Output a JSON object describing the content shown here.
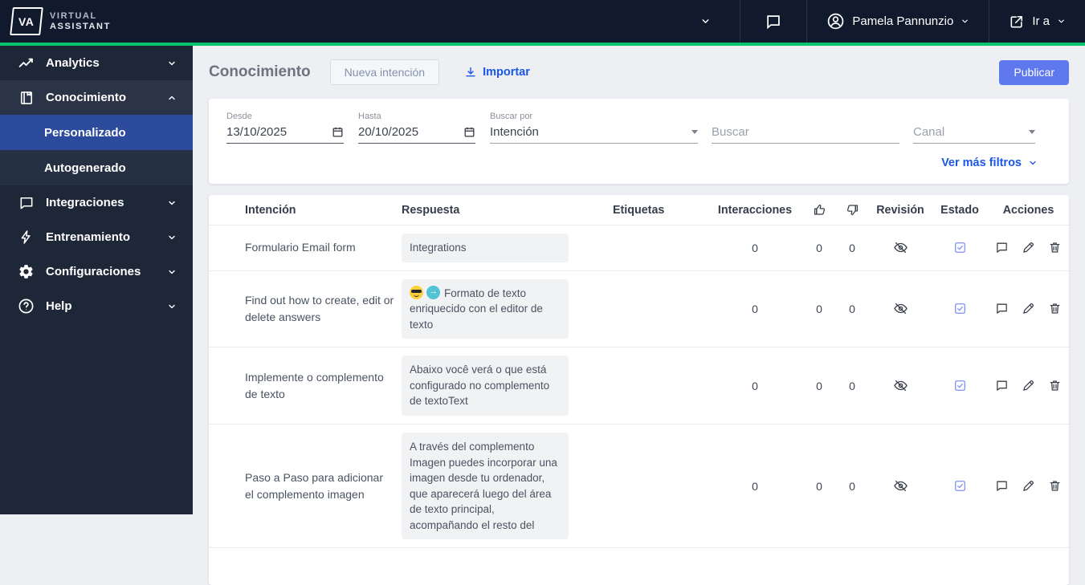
{
  "topbar": {
    "logo": {
      "badge": "VA",
      "name_line1": "VIRTUAL",
      "name_line2": "ASSISTANT"
    },
    "user_name": "Pamela Pannunzio",
    "go_to_label": "Ir a"
  },
  "sidebar": {
    "items": [
      {
        "label": "Analytics",
        "icon": "line-chart-icon",
        "state": "collapsed"
      },
      {
        "label": "Conocimiento",
        "icon": "book-icon",
        "state": "expanded"
      },
      {
        "label": "Personalizado",
        "state": "active-subitem"
      },
      {
        "label": "Autogenerado",
        "state": "subitem"
      },
      {
        "label": "Integraciones",
        "icon": "chat-bubble-icon",
        "state": "collapsed"
      },
      {
        "label": "Entrenamiento",
        "icon": "lightning-icon",
        "state": "collapsed"
      },
      {
        "label": "Configuraciones",
        "icon": "gear-icon",
        "state": "collapsed"
      },
      {
        "label": "Help",
        "icon": "help-circle-icon",
        "state": "collapsed"
      }
    ]
  },
  "page": {
    "title": "Conocimiento",
    "new_intent_button": "Nueva intención",
    "import_label": "Importar",
    "publish_button": "Publicar"
  },
  "filters": {
    "from_label": "Desde",
    "from_value": "13/10/2025",
    "to_label": "Hasta",
    "to_value": "20/10/2025",
    "search_by_label": "Buscar por",
    "search_by_value": "Intención",
    "search_placeholder": "Buscar",
    "search_value": "",
    "channel_placeholder": "Canal",
    "channel_value": "",
    "more_filters_label": "Ver más filtros"
  },
  "table": {
    "headers": {
      "intent": "Intención",
      "response": "Respuesta",
      "tags": "Etiquetas",
      "interactions": "Interacciones",
      "likes_icon": "thumbs-up-icon",
      "dislikes_icon": "thumbs-down-icon",
      "review": "Revisión",
      "status": "Estado",
      "actions": "Acciones"
    },
    "rows": [
      {
        "intent": "Formulario Email form",
        "response": "Integrations",
        "has_icons": false,
        "interactions": "0",
        "likes": "0",
        "dislikes": "0",
        "review_icon": "eye-off-icon",
        "status_icon": "checkbox-checked-icon"
      },
      {
        "intent": "Find out how to create, edit or delete answers",
        "response": "Formato de texto enriquecido con el editor de texto",
        "has_icons": true,
        "interactions": "0",
        "likes": "0",
        "dislikes": "0",
        "review_icon": "eye-off-icon",
        "status_icon": "checkbox-checked-icon"
      },
      {
        "intent": "Implemente o complemento de texto",
        "response": "Abaixo você verá o que está configurado no complemento de textoText",
        "has_icons": false,
        "interactions": "0",
        "likes": "0",
        "dislikes": "0",
        "review_icon": "eye-off-icon",
        "status_icon": "checkbox-checked-icon"
      },
      {
        "intent": "Paso a Paso para adicionar el complemento imagen",
        "response": "A través del complemento Imagen puedes incorporar una imagen desde tu ordenador, que aparecerá luego del área de texto principal, acompañando el resto del",
        "has_icons": false,
        "interactions": "0",
        "likes": "0",
        "dislikes": "0",
        "review_icon": "eye-off-icon",
        "status_icon": "checkbox-checked-icon"
      }
    ]
  },
  "colors": {
    "topbar_bg": "#111a2d",
    "sidebar_bg": "#1e2738",
    "accent_green": "#00c46b",
    "active_nav_blue": "#2c4b9c",
    "link_blue": "#1a56e8",
    "publish_blue": "#5f78ee",
    "status_check_blue": "#8d9af5"
  }
}
